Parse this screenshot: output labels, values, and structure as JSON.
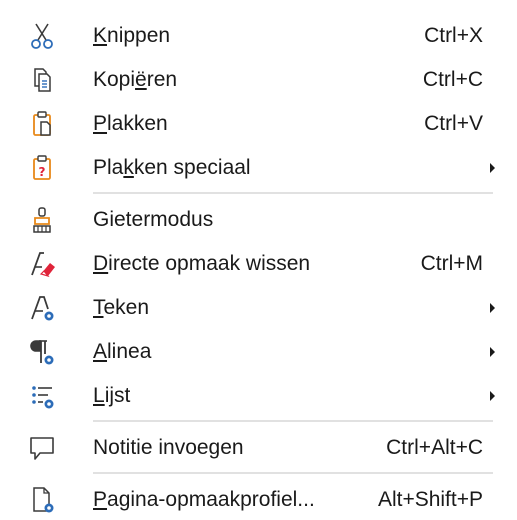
{
  "context_menu": {
    "items": [
      {
        "icon": "scissors-icon",
        "label_pre": "",
        "label_mn": "K",
        "label_post": "nippen",
        "shortcut": "Ctrl+X"
      },
      {
        "icon": "copy-icon",
        "label_pre": "Kopi",
        "label_mn": "ë",
        "label_post": "ren",
        "shortcut": "Ctrl+C"
      },
      {
        "icon": "paste-icon",
        "label_pre": "",
        "label_mn": "P",
        "label_post": "lakken",
        "shortcut": "Ctrl+V"
      },
      {
        "icon": "paste-special-icon",
        "label_pre": "Pla",
        "label_mn": "k",
        "label_post": "ken speciaal",
        "shortcut": "",
        "submenu": true
      },
      {
        "icon": "paintbrush-icon",
        "label_pre": "Gietermodus",
        "label_mn": "",
        "label_post": "",
        "shortcut": ""
      },
      {
        "icon": "clear-formatting-icon",
        "label_pre": "",
        "label_mn": "D",
        "label_post": "irecte opmaak wissen",
        "shortcut": "Ctrl+M"
      },
      {
        "icon": "character-settings-icon",
        "label_pre": "",
        "label_mn": "T",
        "label_post": "eken",
        "shortcut": "",
        "submenu": true
      },
      {
        "icon": "paragraph-settings-icon",
        "label_pre": "",
        "label_mn": "A",
        "label_post": "linea",
        "shortcut": "",
        "submenu": true
      },
      {
        "icon": "list-settings-icon",
        "label_pre": "",
        "label_mn": "L",
        "label_post": "ijst",
        "shortcut": "",
        "submenu": true
      },
      {
        "icon": "comment-icon",
        "label_pre": "Notitie invoegen",
        "label_mn": "",
        "label_post": "",
        "shortcut": "Ctrl+Alt+C"
      },
      {
        "icon": "page-style-icon",
        "label_pre": "",
        "label_mn": "P",
        "label_post": "agina-opmaakprofiel...",
        "shortcut": "Alt+Shift+P"
      }
    ],
    "colors": {
      "accent_blue": "#2c6cb8",
      "accent_orange": "#e8891a",
      "accent_red": "#e0243a",
      "icon_stroke": "#3a3a3a",
      "separator": "#e1e1e1"
    }
  }
}
